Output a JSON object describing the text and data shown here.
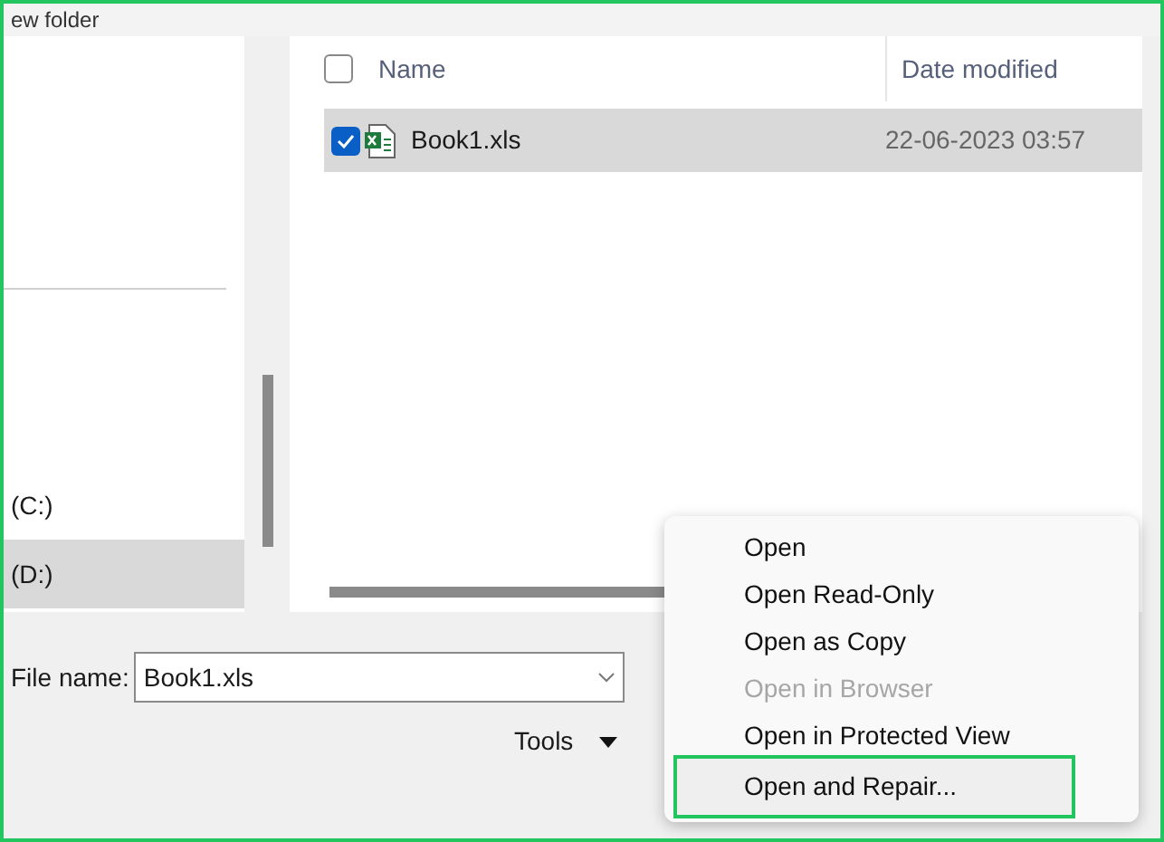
{
  "toolbar": {
    "title": "ew folder"
  },
  "nav": {
    "items": [
      {
        "label": "(C:)",
        "selected": false
      },
      {
        "label": "(D:)",
        "selected": true
      }
    ]
  },
  "file_list": {
    "columns": [
      "Name",
      "Date modified"
    ],
    "header_checked": false,
    "rows": [
      {
        "name": "Book1.xls",
        "date": "22-06-2023 03:57",
        "selected": true
      }
    ]
  },
  "file_name": {
    "label": "File name:",
    "value": "Book1.xls"
  },
  "tools": {
    "label": "Tools"
  },
  "open_menu": {
    "items": [
      {
        "label": "Open",
        "disabled": false,
        "highlighted": false
      },
      {
        "label": "Open Read-Only",
        "disabled": false,
        "highlighted": false
      },
      {
        "label": "Open as Copy",
        "disabled": false,
        "highlighted": false
      },
      {
        "label": "Open in Browser",
        "disabled": true,
        "highlighted": false
      },
      {
        "label": "Open in Protected View",
        "disabled": false,
        "highlighted": false
      },
      {
        "label": "Open and Repair...",
        "disabled": false,
        "highlighted": true
      }
    ]
  }
}
